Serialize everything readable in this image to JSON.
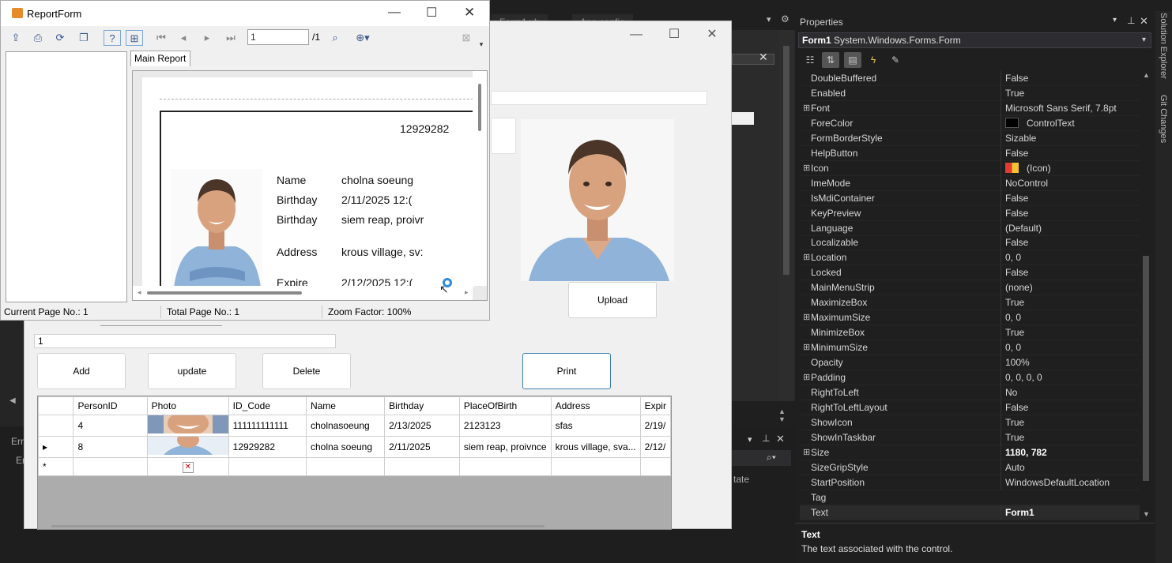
{
  "ide": {
    "tabs": [
      "Form1.vb",
      "App.config"
    ]
  },
  "properties": {
    "header": "Properties",
    "object_name": "Form1",
    "object_type": "System.Windows.Forms.Form",
    "rows": [
      {
        "name": "DoubleBuffered",
        "value": "False",
        "expandable": false
      },
      {
        "name": "Enabled",
        "value": "True",
        "expandable": false
      },
      {
        "name": "Font",
        "value": "Microsoft Sans Serif, 7.8pt",
        "expandable": true
      },
      {
        "name": "ForeColor",
        "value": "ControlText",
        "expandable": false,
        "swatch": "#000000"
      },
      {
        "name": "FormBorderStyle",
        "value": "Sizable",
        "expandable": false
      },
      {
        "name": "HelpButton",
        "value": "False",
        "expandable": false
      },
      {
        "name": "Icon",
        "value": "(Icon)",
        "expandable": true,
        "swatch": "icon"
      },
      {
        "name": "ImeMode",
        "value": "NoControl",
        "expandable": false
      },
      {
        "name": "IsMdiContainer",
        "value": "False",
        "expandable": false
      },
      {
        "name": "KeyPreview",
        "value": "False",
        "expandable": false
      },
      {
        "name": "Language",
        "value": "(Default)",
        "expandable": false
      },
      {
        "name": "Localizable",
        "value": "False",
        "expandable": false
      },
      {
        "name": "Location",
        "value": "0, 0",
        "expandable": true
      },
      {
        "name": "Locked",
        "value": "False",
        "expandable": false
      },
      {
        "name": "MainMenuStrip",
        "value": "(none)",
        "expandable": false
      },
      {
        "name": "MaximizeBox",
        "value": "True",
        "expandable": false
      },
      {
        "name": "MaximumSize",
        "value": "0, 0",
        "expandable": true
      },
      {
        "name": "MinimizeBox",
        "value": "True",
        "expandable": false
      },
      {
        "name": "MinimumSize",
        "value": "0, 0",
        "expandable": true
      },
      {
        "name": "Opacity",
        "value": "100%",
        "expandable": false
      },
      {
        "name": "Padding",
        "value": "0, 0, 0, 0",
        "expandable": true
      },
      {
        "name": "RightToLeft",
        "value": "No",
        "expandable": false
      },
      {
        "name": "RightToLeftLayout",
        "value": "False",
        "expandable": false
      },
      {
        "name": "ShowIcon",
        "value": "True",
        "expandable": false
      },
      {
        "name": "ShowInTaskbar",
        "value": "True",
        "expandable": false
      },
      {
        "name": "Size",
        "value": "1180, 782",
        "expandable": true,
        "bold": true
      },
      {
        "name": "SizeGripStyle",
        "value": "Auto",
        "expandable": false
      },
      {
        "name": "StartPosition",
        "value": "WindowsDefaultLocation",
        "expandable": false
      },
      {
        "name": "Tag",
        "value": "",
        "expandable": false
      },
      {
        "name": "Text",
        "value": "Form1",
        "expandable": false,
        "bold": true
      }
    ],
    "description_title": "Text",
    "description": "The text associated with the control."
  },
  "side_tabs": [
    "Solution Explorer",
    "Git Changes"
  ],
  "form1": {
    "input_value": "1",
    "buttons": {
      "add": "Add",
      "update": "update",
      "delete": "Delete",
      "upload": "Upload",
      "print": "Print"
    },
    "grid": {
      "columns": [
        "PersonID",
        "Photo",
        "ID_Code",
        "Name",
        "Birthday",
        "PlaceOfBirth",
        "Address",
        "Expir"
      ],
      "rows": [
        {
          "indicator": "",
          "PersonID": "4",
          "ID_Code": "111111111111",
          "Name": "cholnasoeung",
          "Birthday": "2/13/2025",
          "PlaceOfBirth": "2123123",
          "Address": "sfas",
          "Expir": "2/19/"
        },
        {
          "indicator": "▸",
          "PersonID": "8",
          "ID_Code": "12929282",
          "Name": "cholna soeung",
          "Birthday": "2/11/2025",
          "PlaceOfBirth": "siem reap, proivnce",
          "Address": "krous village, sva...",
          "Expir": "2/12/"
        },
        {
          "indicator": "*",
          "PersonID": "",
          "ID_Code": "",
          "Name": "",
          "Birthday": "",
          "PlaceOfBirth": "",
          "Address": "",
          "Expir": ""
        }
      ]
    }
  },
  "report": {
    "title": "ReportForm",
    "page_value": "1",
    "page_total": "/1",
    "tab_label": "Main Report",
    "id_code": "12929282",
    "fields": [
      {
        "label": "Name",
        "value": "cholna soeung"
      },
      {
        "label": "Birthday",
        "value": "2/11/2025  12:("
      },
      {
        "label": "Birthday",
        "value": "siem reap, proivr"
      },
      {
        "label": "Address",
        "value": "krous village, sv:"
      },
      {
        "label": "Expire",
        "value": "2/12/2025  12:("
      }
    ],
    "status": {
      "current_page": "Current Page No.: 1",
      "total_page": "Total Page No.: 1",
      "zoom": "Zoom Factor: 100%"
    }
  },
  "colors": {
    "accent": "#007acc",
    "print_border": "#3c7fb1"
  }
}
